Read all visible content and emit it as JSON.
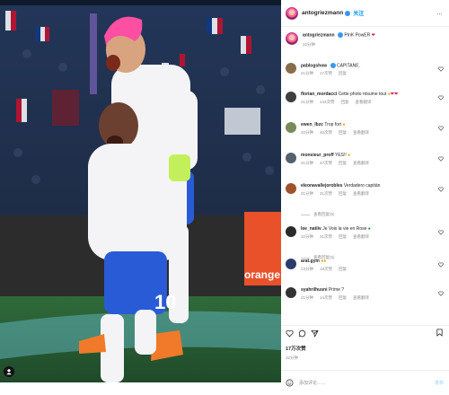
{
  "post": {
    "username": "antogriezmann",
    "follow_label": "关注",
    "more_label": "…",
    "caption": {
      "text": "PInK PowER",
      "time": "32分钟"
    },
    "likes": "17万次赞",
    "date": "32分钟",
    "add_comment_placeholder": "添加评论……",
    "post_label": "发布",
    "photo_banner": "orange"
  },
  "comments": [
    {
      "user": "pablogshow",
      "text": "CAPITANE.",
      "time": "21分钟",
      "likes": "17次赞",
      "reply": "回复",
      "avatar_color": "#8a6d4a"
    },
    {
      "user": "florian_mordacci",
      "text": "Cette photo résume tout",
      "time": "31分钟",
      "likes": "143次赞",
      "reply": "回复",
      "extra": "查看翻译",
      "avatar_color": "#3f3f3f"
    },
    {
      "user": "ewen_lbzc",
      "text": "Trop fort",
      "time": "32分钟",
      "likes": "45次赞",
      "reply": "回复",
      "extra": "查看翻译",
      "avatar_color": "#7a8a5a"
    },
    {
      "user": "monsieur_proff",
      "text": "YES!!",
      "time": "31分钟",
      "likes": "37次赞",
      "reply": "回复",
      "extra": "查看翻译",
      "avatar_color": "#556070"
    },
    {
      "user": "eleonavallejorobles",
      "text": "Verdadero capitán",
      "time": "31分钟",
      "likes": "31次赞",
      "reply": "回复",
      "extra": "查看翻译",
      "view_replies": "查看回复(5)",
      "avatar_color": "#a0522d"
    },
    {
      "user": "lee_natiiv",
      "text": "Je Vois la vie en Rose",
      "time": "32分钟",
      "likes": "31次赞",
      "reply": "回复",
      "extra": "查看翻译",
      "view_replies": "查看回复(5)",
      "avatar_color": "#2a2a2a"
    },
    {
      "user": "arat.gym",
      "text": "",
      "time": "23分钟",
      "likes": "18次赞",
      "reply": "回复",
      "avatar_color": "#2b3b6b"
    },
    {
      "user": "syahrilhusni",
      "text": "Prime ?",
      "time": "21分钟",
      "likes": "14次赞",
      "reply": "回复",
      "extra": "查看翻译",
      "avatar_color": "#333333"
    }
  ],
  "icons": {
    "heart": "heart-icon",
    "comment": "comment-icon",
    "share": "share-icon",
    "bookmark": "bookmark-icon",
    "emoji": "emoji-icon",
    "user_tag": "user-tag-icon"
  },
  "colors": {
    "accent": "#0095f6",
    "verified": "#3897f0",
    "muted": "#8e8e8e"
  }
}
